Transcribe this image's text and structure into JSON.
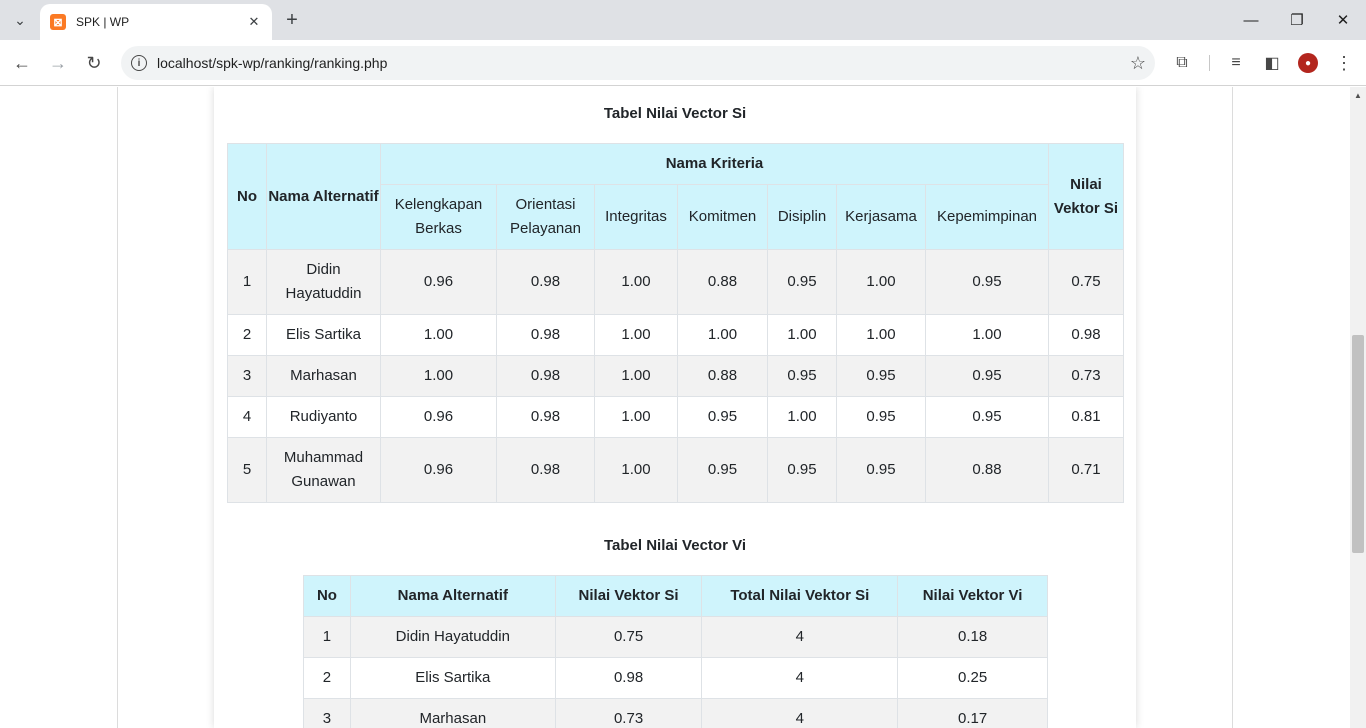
{
  "browser": {
    "tab_title": "SPK | WP",
    "favicon_text": "⊠",
    "url": "localhost/spk-wp/ranking/ranking.php"
  },
  "page": {
    "si_title": "Tabel Nilai Vector Si",
    "vi_title": "Tabel Nilai Vector Vi",
    "si_table": {
      "col_no": "No",
      "col_alt": "Nama Alternatif",
      "col_kriteria": "Nama Kriteria",
      "col_si": "Nilai Vektor Si",
      "criteria": [
        "Kelengkapan Berkas",
        "Orientasi Pelayanan",
        "Integritas",
        "Komitmen",
        "Disiplin",
        "Kerjasama",
        "Kepemimpinan"
      ],
      "rows": [
        {
          "no": "1",
          "name": "Didin Hayatuddin",
          "vals": [
            "0.96",
            "0.98",
            "1.00",
            "0.88",
            "0.95",
            "1.00",
            "0.95"
          ],
          "si": "0.75"
        },
        {
          "no": "2",
          "name": "Elis Sartika",
          "vals": [
            "1.00",
            "0.98",
            "1.00",
            "1.00",
            "1.00",
            "1.00",
            "1.00"
          ],
          "si": "0.98"
        },
        {
          "no": "3",
          "name": "Marhasan",
          "vals": [
            "1.00",
            "0.98",
            "1.00",
            "0.88",
            "0.95",
            "0.95",
            "0.95"
          ],
          "si": "0.73"
        },
        {
          "no": "4",
          "name": "Rudiyanto",
          "vals": [
            "0.96",
            "0.98",
            "1.00",
            "0.95",
            "1.00",
            "0.95",
            "0.95"
          ],
          "si": "0.81"
        },
        {
          "no": "5",
          "name": "Muhammad Gunawan",
          "vals": [
            "0.96",
            "0.98",
            "1.00",
            "0.95",
            "0.95",
            "0.95",
            "0.88"
          ],
          "si": "0.71"
        }
      ]
    },
    "vi_table": {
      "headers": [
        "No",
        "Nama Alternatif",
        "Nilai Vektor Si",
        "Total Nilai Vektor Si",
        "Nilai Vektor Vi"
      ],
      "rows": [
        {
          "no": "1",
          "name": "Didin Hayatuddin",
          "si": "0.75",
          "total": "4",
          "vi": "0.18"
        },
        {
          "no": "2",
          "name": "Elis Sartika",
          "si": "0.98",
          "total": "4",
          "vi": "0.25"
        },
        {
          "no": "3",
          "name": "Marhasan",
          "si": "0.73",
          "total": "4",
          "vi": "0.17"
        }
      ]
    }
  }
}
